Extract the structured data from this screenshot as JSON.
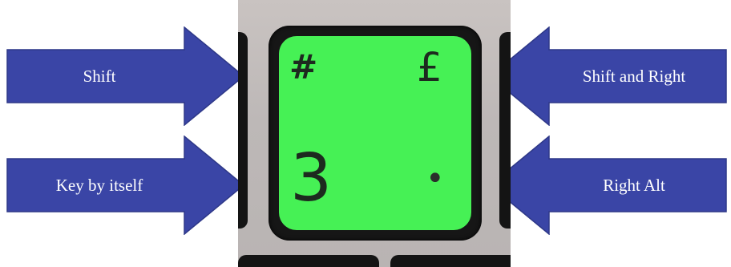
{
  "labels": {
    "shift": "Shift",
    "key_by_itself": "Key by itself",
    "shift_and_right": "Shift and Right",
    "right_alt": "Right Alt"
  },
  "key": {
    "top_left": "#",
    "top_right": "£",
    "bottom_left": "3",
    "bottom_right": "•"
  },
  "colors": {
    "arrow_fill": "#3a45a6",
    "arrow_stroke": "#2e3888",
    "key_fill": "#46f155",
    "key_surround": "#161616"
  }
}
